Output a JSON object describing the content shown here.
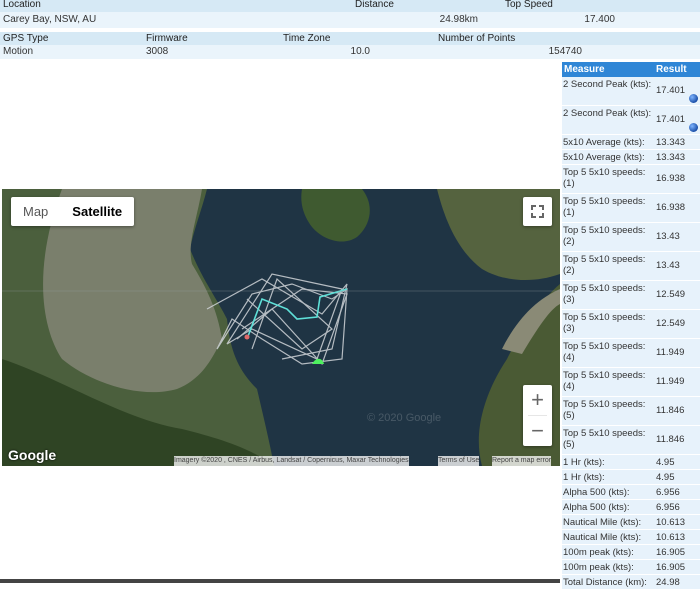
{
  "summary": {
    "headers1": {
      "location": "Location",
      "distance": "Distance",
      "top_speed": "Top Speed"
    },
    "values1": {
      "location": "Carey Bay, NSW, AU",
      "distance": "24.98km",
      "top_speed": "17.400"
    },
    "headers2": {
      "gps_type": "GPS Type",
      "firmware": "Firmware",
      "time_zone": "Time Zone",
      "num_points": "Number of Points"
    },
    "values2": {
      "gps_type": "Motion",
      "firmware": "3008",
      "time_zone": "10.0",
      "num_points": "154740"
    }
  },
  "measures": {
    "header_measure": "Measure",
    "header_result": "Result",
    "rows": [
      {
        "label": "2 Second Peak (kts):",
        "value": "17.401",
        "globe": true
      },
      {
        "label": "2 Second Peak (kts):",
        "value": "17.401",
        "globe": true
      },
      {
        "label": "5x10 Average (kts):",
        "value": "13.343"
      },
      {
        "label": "5x10 Average (kts):",
        "value": "13.343"
      },
      {
        "label": "Top 5 5x10 speeds: (1)",
        "value": "16.938"
      },
      {
        "label": "Top 5 5x10 speeds: (1)",
        "value": "16.938"
      },
      {
        "label": "Top 5 5x10 speeds: (2)",
        "value": "13.43"
      },
      {
        "label": "Top 5 5x10 speeds: (2)",
        "value": "13.43"
      },
      {
        "label": "Top 5 5x10 speeds: (3)",
        "value": "12.549"
      },
      {
        "label": "Top 5 5x10 speeds: (3)",
        "value": "12.549"
      },
      {
        "label": "Top 5 5x10 speeds: (4)",
        "value": "11.949"
      },
      {
        "label": "Top 5 5x10 speeds: (4)",
        "value": "11.949"
      },
      {
        "label": "Top 5 5x10 speeds: (5)",
        "value": "11.846"
      },
      {
        "label": "Top 5 5x10 speeds: (5)",
        "value": "11.846"
      },
      {
        "label": "1 Hr (kts):",
        "value": "4.95"
      },
      {
        "label": "1 Hr (kts):",
        "value": "4.95"
      },
      {
        "label": "Alpha 500 (kts):",
        "value": "6.956"
      },
      {
        "label": "Alpha 500 (kts):",
        "value": "6.956"
      },
      {
        "label": "Nautical Mile (kts):",
        "value": "10.613"
      },
      {
        "label": "Nautical Mile (kts):",
        "value": "10.613"
      },
      {
        "label": "100m peak (kts):",
        "value": "16.905"
      },
      {
        "label": "100m peak (kts):",
        "value": "16.905"
      },
      {
        "label": "Total Distance (km):",
        "value": "24.98"
      }
    ]
  },
  "map": {
    "type_map": "Map",
    "type_satellite": "Satellite",
    "selected": "Satellite",
    "zoom_in": "+",
    "zoom_out": "−",
    "logo": "Google",
    "attribution": "Imagery ©2020 , CNES / Airbus, Landsat / Copernicus, Maxar Technologies",
    "terms": "Terms of Use",
    "report": "Report a map error",
    "watermark": "© 2020 Google",
    "track_color": "#5fe0d8"
  }
}
